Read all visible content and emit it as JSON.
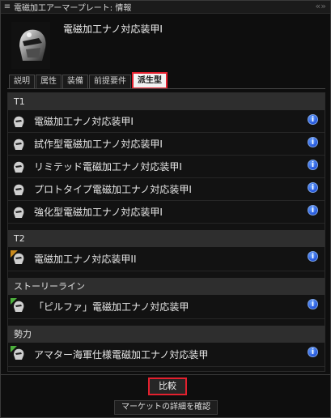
{
  "window": {
    "title": "電磁加工アーマープレート: 情報",
    "menu_glyph": "≡",
    "collapse_glyph": "«»"
  },
  "item": {
    "name": "電磁加工ナノ対応装甲I"
  },
  "tabs": [
    {
      "label": "説明",
      "active": false
    },
    {
      "label": "属性",
      "active": false
    },
    {
      "label": "装備",
      "active": false
    },
    {
      "label": "前提要件",
      "active": false
    },
    {
      "label": "派生型",
      "active": true
    }
  ],
  "groups": [
    {
      "title": "T1",
      "items": [
        {
          "label": "電磁加工ナノ対応装甲I"
        },
        {
          "label": "試作型電磁加工ナノ対応装甲I"
        },
        {
          "label": "リミテッド電磁加工ナノ対応装甲I"
        },
        {
          "label": "プロトタイプ電磁加工ナノ対応装甲I"
        },
        {
          "label": "強化型電磁加工ナノ対応装甲I"
        }
      ]
    },
    {
      "title": "T2",
      "items": [
        {
          "label": "電磁加工ナノ対応装甲II",
          "badge": "II",
          "badge_color": "#c98a1d"
        }
      ]
    },
    {
      "title": "ストーリーライン",
      "items": [
        {
          "label": "「ピルファ」電磁加工ナノ対応装甲",
          "badge_color": "#4caf3c"
        }
      ]
    },
    {
      "title": "勢力",
      "items": [
        {
          "label": "アマター海軍仕様電磁加工ナノ対応装甲",
          "badge_color": "#4caf3c"
        }
      ]
    }
  ],
  "info_glyph": "i",
  "buttons": {
    "compare": "比較",
    "market_details": "マーケットの詳細を確認"
  },
  "colors": {
    "highlight": "#e3202e",
    "info": "#2f6df0"
  }
}
